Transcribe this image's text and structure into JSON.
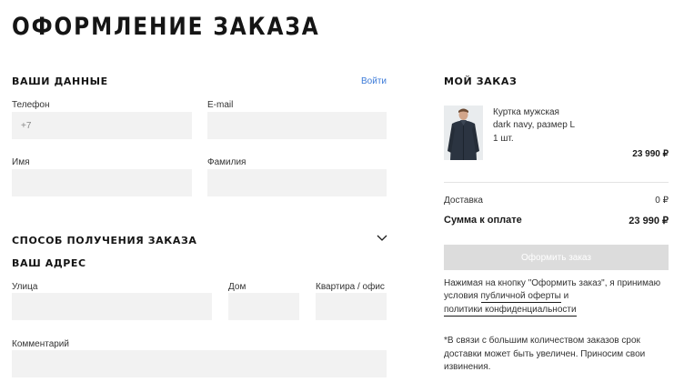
{
  "page": {
    "title": "ОФОРМЛЕНИЕ ЗАКАЗА"
  },
  "your_data": {
    "title": "ВАШИ ДАННЫЕ",
    "login_link": "Войти",
    "phone_label": "Телефон",
    "phone_placeholder": "+7",
    "email_label": "E-mail",
    "name_label": "Имя",
    "surname_label": "Фамилия"
  },
  "delivery": {
    "title": "СПОСОБ ПОЛУЧЕНИЯ ЗАКАЗА",
    "address_title": "ВАШ АДРЕС",
    "street_label": "Улица",
    "house_label": "Дом",
    "apartment_label": "Квартира / офис",
    "comment_label": "Комментарий"
  },
  "order": {
    "title": "МОЙ ЗАКАЗ",
    "item": {
      "name": "Куртка мужская",
      "variant": "dark navy, размер L",
      "quantity": "1 шт.",
      "price": "23 990 ₽"
    },
    "shipping_label": "Доставка",
    "shipping_value": "0 ₽",
    "total_label": "Сумма к оплате",
    "total_value": "23 990 ₽",
    "submit_label": "Оформить заказ",
    "consent_text_1": "Нажимая на кнопку \"Оформить заказ\", я принимаю",
    "consent_text_2": "условия",
    "consent_offer_link": "публичной оферты",
    "consent_and": "и",
    "consent_privacy_link": "политики конфиденциальности",
    "notice_line_1": "*В связи с большим количеством заказов срок",
    "notice_line_2": "доставки может быть увеличен. Приносим свои",
    "notice_line_3": "извинения."
  },
  "colors": {
    "accent_link": "#3b7ad8",
    "field_bg": "#f2f2f2",
    "button_disabled": "#dcdcdc"
  }
}
